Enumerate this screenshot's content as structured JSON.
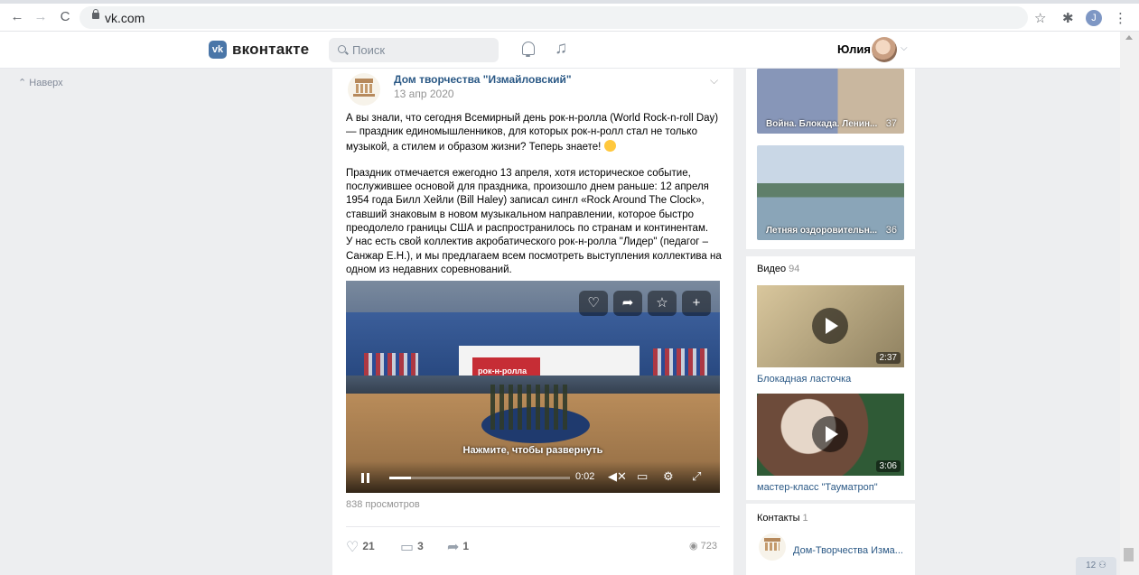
{
  "browser": {
    "url": "vk.com",
    "profile_initial": "J",
    "nav": {
      "back": "←",
      "forward": "→",
      "reload": "C"
    }
  },
  "header": {
    "logo_text": "вконтакте",
    "logo_mark": "vk",
    "search_placeholder": "Поиск",
    "user_name": "Юлия"
  },
  "sidebar": {
    "up_label": "Наверх"
  },
  "post": {
    "group_name": "Дом творчества \"Измайловский\"",
    "date": "13 апр 2020",
    "paragraph1": "А вы знали, что сегодня Всемирный день рок-н-ролла (World Rock-n-roll Day) — праздник единомышленников, для которых рок-н-ролл стал не только музыкой, а стилем и образом жизни? Теперь знаете!",
    "paragraph2": "Праздник отмечается ежегодно 13 апреля, хотя историческое событие, послужившее основой для праздника, произошло днем раньше: 12 апреля 1954 года Билл Хейли (Bill Haley) записал сингл «Rock Around The Clock», ставший знаковым в новом музыкальном направлении, которое быстро преодолело границы США и распространилось по странам и континентам.",
    "paragraph3": "У нас есть свой коллектив акробатического рок-н-ролла \"Лидер\" (педагог – Санжар Е.Н.), и мы предлагаем всем посмотреть выступления коллектива на одном из недавних соревнований.",
    "video": {
      "expand_label": "Нажмите, чтобы развернуть",
      "time": "0:02",
      "progress": 0.12,
      "board_text": "рок-н-ролла"
    },
    "views_text": "838 просмотров",
    "likes": "21",
    "comments": "3",
    "shares": "1",
    "view_count": "723"
  },
  "right": {
    "photos": [
      {
        "caption": "Война. Блокада. Ленин...",
        "count": "37"
      },
      {
        "caption": "Летняя оздоровительн...",
        "count": "36"
      }
    ],
    "videos_title": "Видео",
    "videos_count": "94",
    "videos": [
      {
        "title": "Блокадная ласточка",
        "duration": "2:37"
      },
      {
        "title": "мастер-класс \"Тауматроп\"",
        "duration": "3:06"
      }
    ],
    "contacts_title": "Контакты",
    "contacts_count": "1",
    "contact_name": "Дом-Творчества Изма..."
  },
  "corner_badge": "12"
}
